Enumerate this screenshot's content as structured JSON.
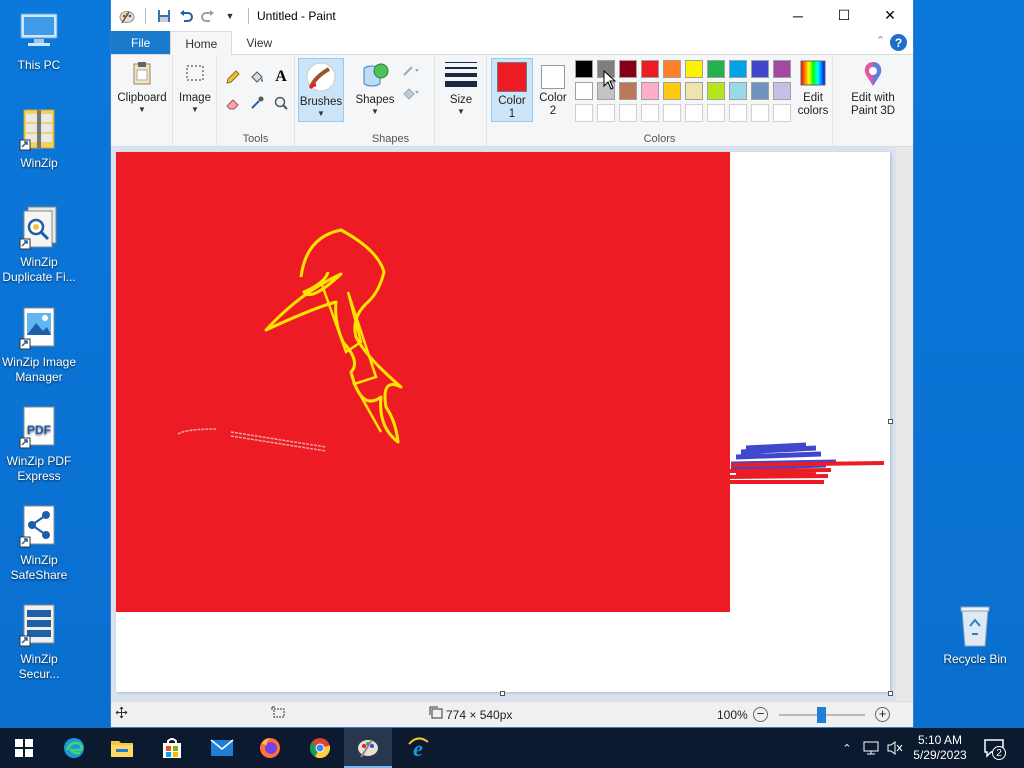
{
  "desktop": {
    "icons": [
      {
        "label": "This PC"
      },
      {
        "label": "WinZip"
      },
      {
        "label": "WinZip Duplicate Fi..."
      },
      {
        "label": "WinZip Image Manager"
      },
      {
        "label": "WinZip PDF Express"
      },
      {
        "label": "WinZip SafeShare"
      },
      {
        "label": "WinZip Secur..."
      },
      {
        "label": "Recycle Bin"
      }
    ],
    "pdf_badge": "PDF"
  },
  "window": {
    "title": "Untitled - Paint",
    "controls": {
      "minimize": "─",
      "maximize": "☐",
      "close": "✕"
    }
  },
  "tabs": {
    "file": "File",
    "home": "Home",
    "view": "View",
    "help": "?"
  },
  "ribbon": {
    "clipboard": {
      "label": "Clipboard"
    },
    "image": {
      "label": "Image"
    },
    "tools": {
      "group_label": "Tools"
    },
    "brushes": {
      "label": "Brushes"
    },
    "shapes": {
      "label": "Shapes",
      "group_label": "Shapes"
    },
    "size": {
      "label": "Size"
    },
    "color1": {
      "label": "Color",
      "label2": "1",
      "color": "#ed1c24"
    },
    "color2": {
      "label": "Color",
      "label2": "2",
      "color": "#ffffff"
    },
    "colors": {
      "group_label": "Colors",
      "palette_row1": [
        "#000000",
        "#7f7f7f",
        "#880015",
        "#ed1c24",
        "#ff7f27",
        "#fff200",
        "#22b14c",
        "#00a2e8",
        "#3f48cc",
        "#a349a4"
      ],
      "palette_row2": [
        "#ffffff",
        "#c3c3c3",
        "#b97a57",
        "#ffaec9",
        "#ffc90e",
        "#efe4b0",
        "#b5e61d",
        "#99d9ea",
        "#7092be",
        "#c8bfe7"
      ]
    },
    "edit_colors": {
      "label": "Edit",
      "label2": "colors"
    },
    "paint3d": {
      "label": "Edit with",
      "label2": "Paint 3D"
    }
  },
  "status": {
    "size": "774 × 540px",
    "zoom": "100%"
  },
  "taskbar": {
    "time": "5:10 AM",
    "date": "5/29/2023",
    "notifications": "2"
  },
  "colors": {
    "desktop": "#0a74d6",
    "accent": "#1979ca",
    "canvas_red": "#ed1c24",
    "stroke_yellow": "#ffe400",
    "stroke_blue": "#3f48cc"
  }
}
